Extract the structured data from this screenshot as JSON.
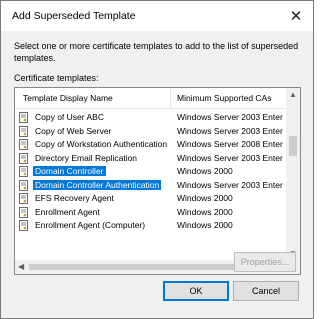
{
  "window": {
    "title": "Add Superseded Template",
    "close_glyph": "✕"
  },
  "intro_text": "Select one or more certificate templates to add to the list of superseded templates.",
  "list_label": "Certificate templates:",
  "columns": {
    "name": "Template Display Name",
    "min_ca": "Minimum Supported CAs"
  },
  "rows": [
    {
      "name": "Copy of User ABC",
      "ca": "Windows Server 2003 Enter",
      "selected": false
    },
    {
      "name": "Copy of Web Server",
      "ca": "Windows Server 2003 Enter",
      "selected": false
    },
    {
      "name": "Copy of Workstation Authentication",
      "ca": "Windows Server 2008 Enter",
      "selected": false
    },
    {
      "name": "Directory Email Replication",
      "ca": "Windows Server 2003 Enter",
      "selected": false
    },
    {
      "name": "Domain Controller",
      "ca": "Windows 2000",
      "selected": true
    },
    {
      "name": "Domain Controller Authentication",
      "ca": "Windows Server 2003 Enter",
      "selected": true
    },
    {
      "name": "EFS Recovery Agent",
      "ca": "Windows 2000",
      "selected": false
    },
    {
      "name": "Enrollment Agent",
      "ca": "Windows 2000",
      "selected": false
    },
    {
      "name": "Enrollment Agent (Computer)",
      "ca": "Windows 2000",
      "selected": false
    }
  ],
  "buttons": {
    "properties": "Properties...",
    "ok": "OK",
    "cancel": "Cancel"
  },
  "colors": {
    "selection": "#0078d7",
    "dialog_bg": "#f0f0f0"
  },
  "icons": {
    "row_icon": "certificate-template-icon"
  }
}
